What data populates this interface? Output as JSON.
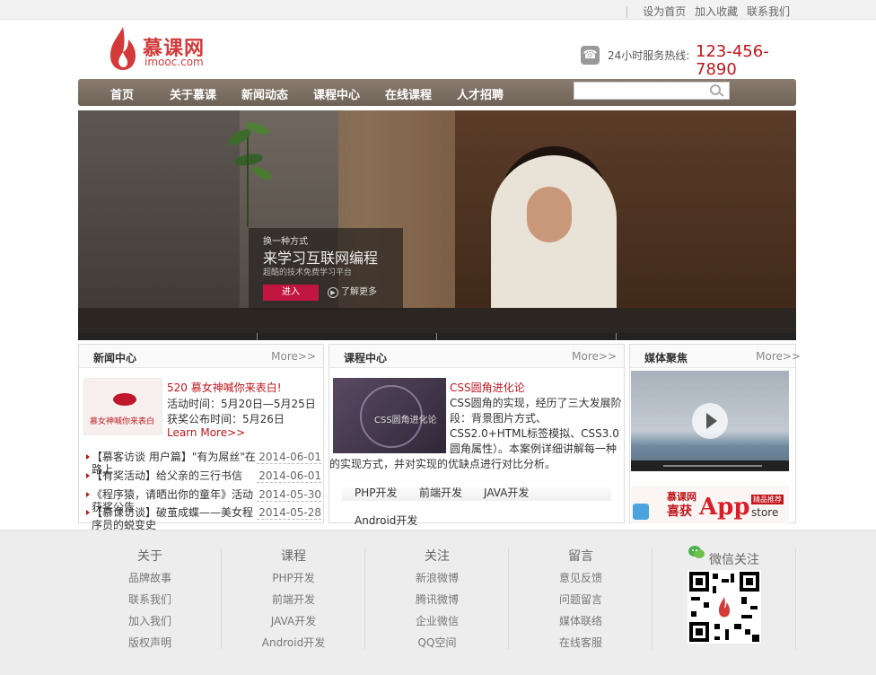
{
  "topbar": {
    "links": [
      "设为首页",
      "加入收藏",
      "联系我们"
    ]
  },
  "header": {
    "logo_text": "慕课网",
    "logo_sub": "imooc.com",
    "hotline_label": "24小时服务热线:",
    "hotline_number": "123-456-7890"
  },
  "nav": {
    "items": [
      "首页",
      "关于慕课",
      "新闻动态",
      "课程中心",
      "在线课程",
      "人才招聘"
    ],
    "search_placeholder": ""
  },
  "banner": {
    "line1": "换一种方式",
    "line2": "来学习互联网编程",
    "line3": "超酷的技术免费学习平台",
    "enter_label": "进入",
    "more_label": "了解更多"
  },
  "news": {
    "title": "新闻中心",
    "more": "More>>",
    "thumb_caption": "慕女神喊你来表白",
    "featured_title": "520 慕女神喊你来表白!",
    "line1": "活动时间：5月20日—5月25日",
    "line2": "获奖公布时间：5月26日",
    "learn_more": "Learn More>>",
    "items": [
      {
        "title": "【慕客访谈 用户篇】\"有为屌丝\"在路上",
        "date": "2014-06-01"
      },
      {
        "title": "【有奖活动】给父亲的三行书信",
        "date": "2014-06-01"
      },
      {
        "title": "《程序猿，请晒出你的童年》活动获奖公告",
        "date": "2014-05-30"
      },
      {
        "title": "【慕课访谈】破茧成蝶——美女程序员的蜕变史",
        "date": "2014-05-28"
      }
    ]
  },
  "course": {
    "title": "课程中心",
    "more": "More>>",
    "thumb_caption": "CSS圆角进化论",
    "featured_title": "CSS圆角进化论",
    "description": "CSS圆角的实现，经历了三大发展阶段：背景图片方式、CSS2.0+HTML标签模拟、CSS3.0圆角属性）。本案例详细讲解每一种的实现方式，并对实现的优缺点进行对比分析。",
    "tabs": [
      "PHP开发",
      "前端开发",
      "JAVA开发",
      "Android开发"
    ]
  },
  "media": {
    "title": "媒体聚焦",
    "more": "More>>",
    "ad_logo": "慕课网",
    "ad_win": "喜获",
    "ad_app": "App",
    "ad_tag": "精品推荐",
    "ad_store": "store"
  },
  "footer": {
    "columns": [
      {
        "heading": "关于",
        "items": [
          "品牌故事",
          "联系我们",
          "加入我们",
          "版权声明"
        ]
      },
      {
        "heading": "课程",
        "items": [
          "PHP开发",
          "前端开发",
          "JAVA开发",
          "Android开发"
        ]
      },
      {
        "heading": "关注",
        "items": [
          "新浪微博",
          "腾讯微博",
          "企业微信",
          "QQ空间"
        ]
      },
      {
        "heading": "留言",
        "items": [
          "意见反馈",
          "问题留言",
          "媒体联络",
          "在线客服"
        ]
      }
    ],
    "wechat_title": "微信关注"
  },
  "colors": {
    "brand_red": "#c0161c",
    "nav_bg": "#7a6d62"
  }
}
